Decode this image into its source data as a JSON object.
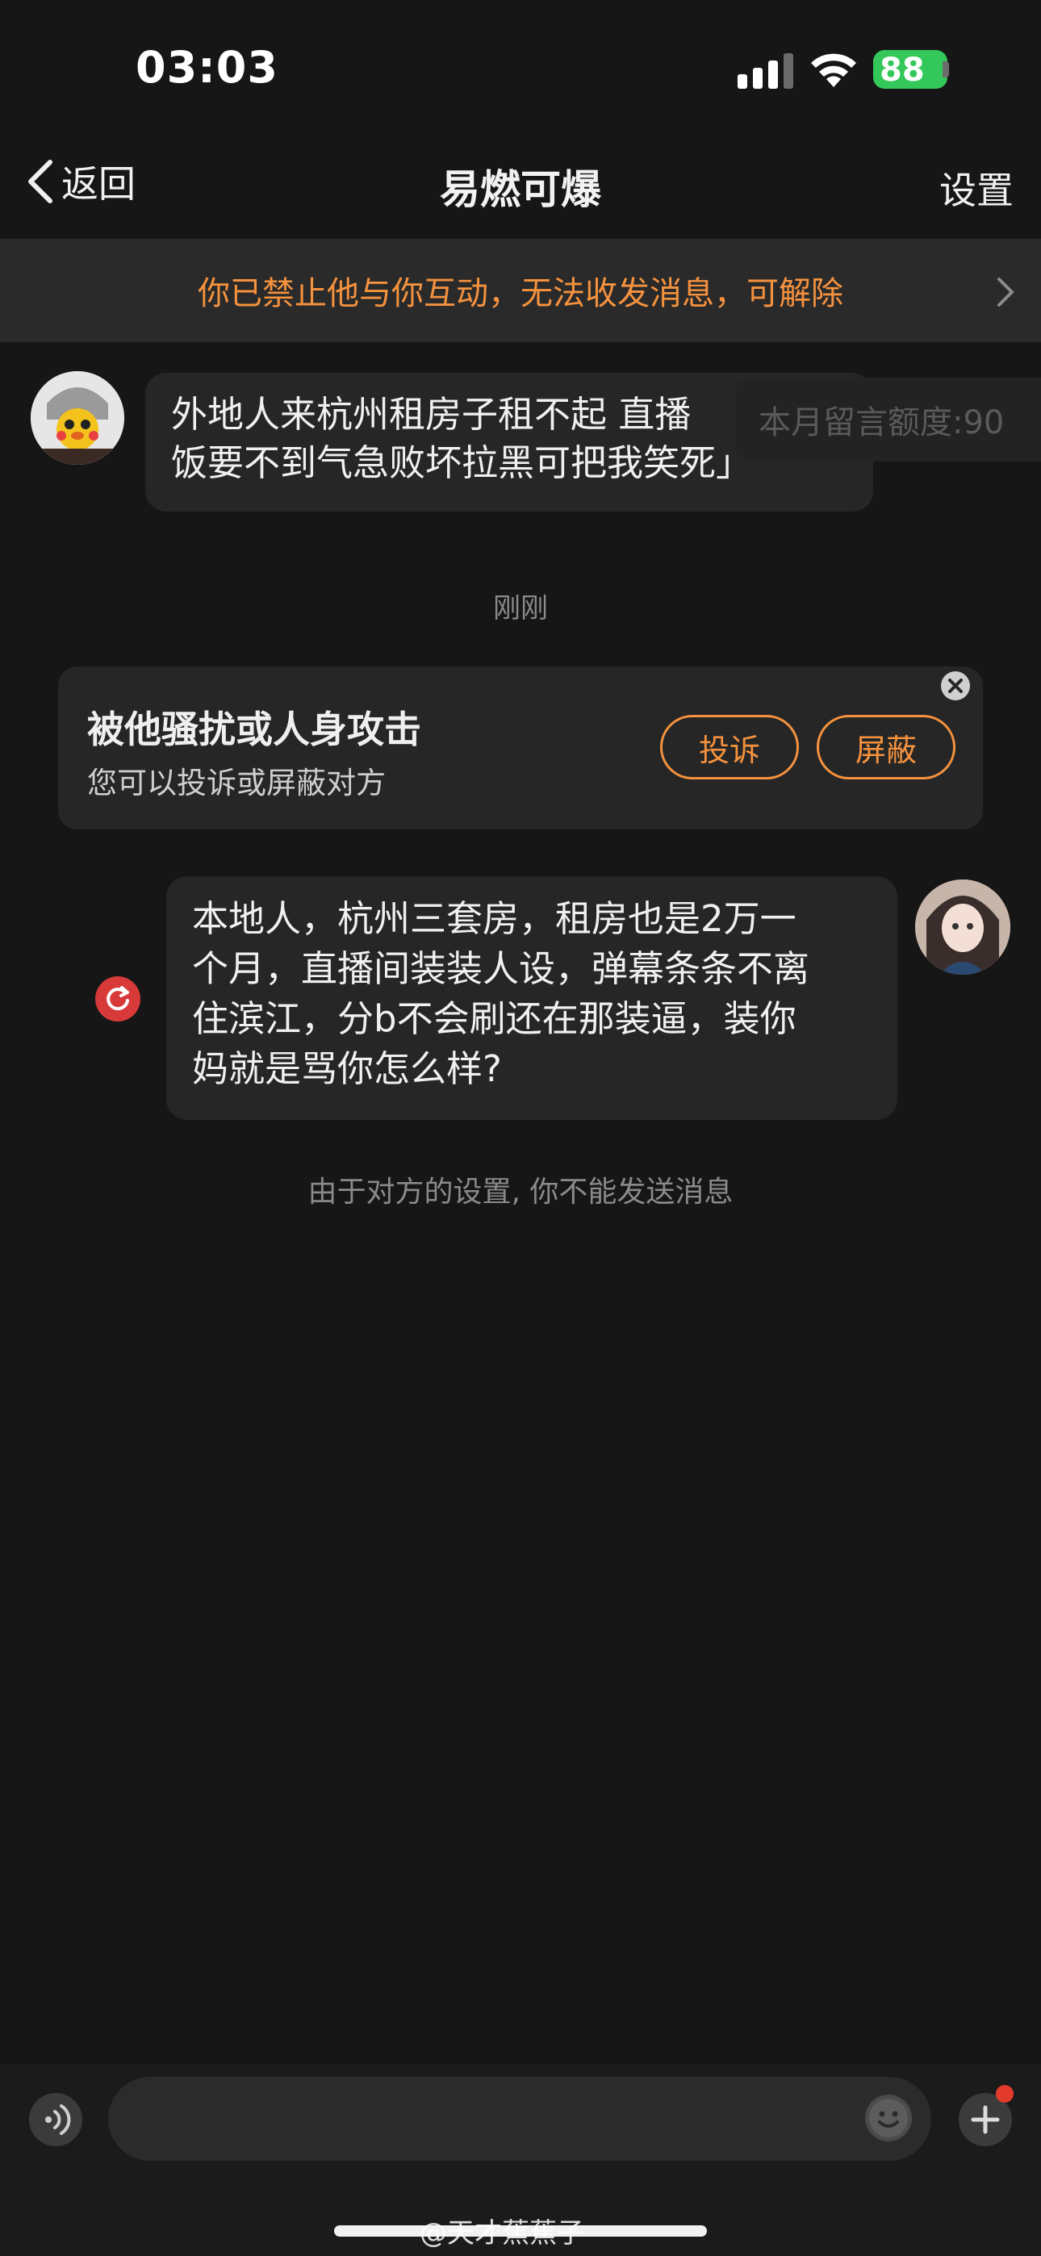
{
  "status_bar": {
    "time": "03:03",
    "battery": "88"
  },
  "nav": {
    "back_label": "返回",
    "title": "易燃可爆",
    "settings_label": "设置"
  },
  "banner": {
    "text": "你已禁止他与你互动，无法收发消息，可解除"
  },
  "incoming_message": {
    "text": "外地人来杭州租房子租不起 直播\n饭要不到气急败坏拉黑可把我笑死」",
    "quota_label": "本月留言额度:90"
  },
  "timestamp": "刚刚",
  "harassment_card": {
    "title": "被他骚扰或人身攻击",
    "subtitle": "您可以投诉或屏蔽对方",
    "report_label": "投诉",
    "block_label": "屏蔽"
  },
  "outgoing_message": {
    "text": "本地人，杭州三套房，租房也是2万一\n个月，直播间装装人设，弹幕条条不离\n住滨江，分b不会刷还在那装逼，装你\n妈就是骂你怎么样?"
  },
  "system_note": "由于对方的设置, 你不能发送消息",
  "input": {
    "placeholder": ""
  },
  "watermark": "@天才蕉蕉子",
  "colors": {
    "accent": "#f5923e",
    "background": "#161616",
    "bubble": "#262626",
    "battery": "#34c759",
    "error": "#d83a3a"
  }
}
